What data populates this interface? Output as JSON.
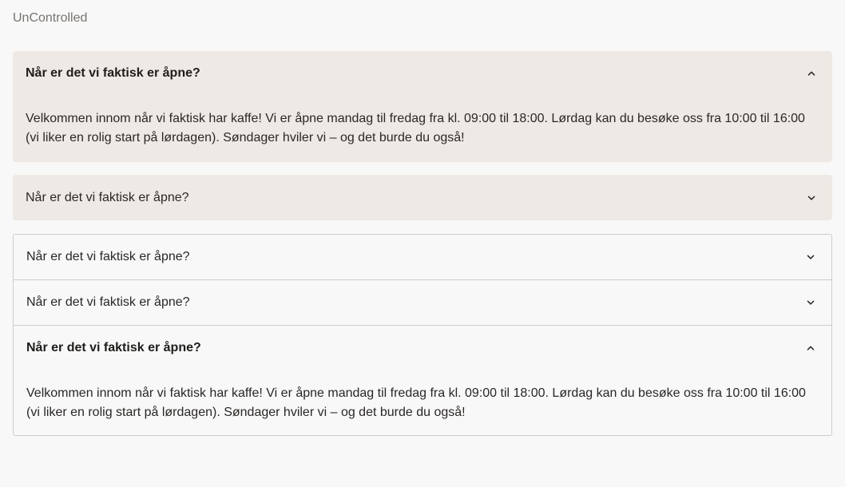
{
  "section_label": "UnControlled",
  "filled_accordion": {
    "items": [
      {
        "title": "Når er det vi faktisk er åpne?",
        "expanded": true,
        "body": "Velkommen innom når vi faktisk har kaffe! Vi er åpne mandag til fredag fra kl. 09:00 til 18:00. Lørdag kan du besøke oss fra 10:00 til 16:00 (vi liker en rolig start på lørdagen). Søndager hviler vi – og det burde du også!"
      },
      {
        "title": "Når er det vi faktisk er åpne?",
        "expanded": false
      }
    ]
  },
  "outlined_accordion": {
    "items": [
      {
        "title": "Når er det vi faktisk er åpne?",
        "expanded": false
      },
      {
        "title": "Når er det vi faktisk er åpne?",
        "expanded": false
      },
      {
        "title": "Når er det vi faktisk er åpne?",
        "expanded": true,
        "body": "Velkommen innom når vi faktisk har kaffe! Vi er åpne mandag til fredag fra kl. 09:00 til 18:00. Lørdag kan du besøke oss fra 10:00 til 16:00 (vi liker en rolig start på lørdagen). Søndager hviler vi – og det burde du også!"
      }
    ]
  },
  "icons": {
    "collapse": "chevron-up-icon",
    "expand": "chevron-down-icon"
  },
  "colors": {
    "page_background": "#f8f8f8",
    "filled_item_background": "#eee9e4",
    "outline_border": "#cfcdca",
    "text": "#2a2725",
    "muted_label": "#77736f"
  }
}
